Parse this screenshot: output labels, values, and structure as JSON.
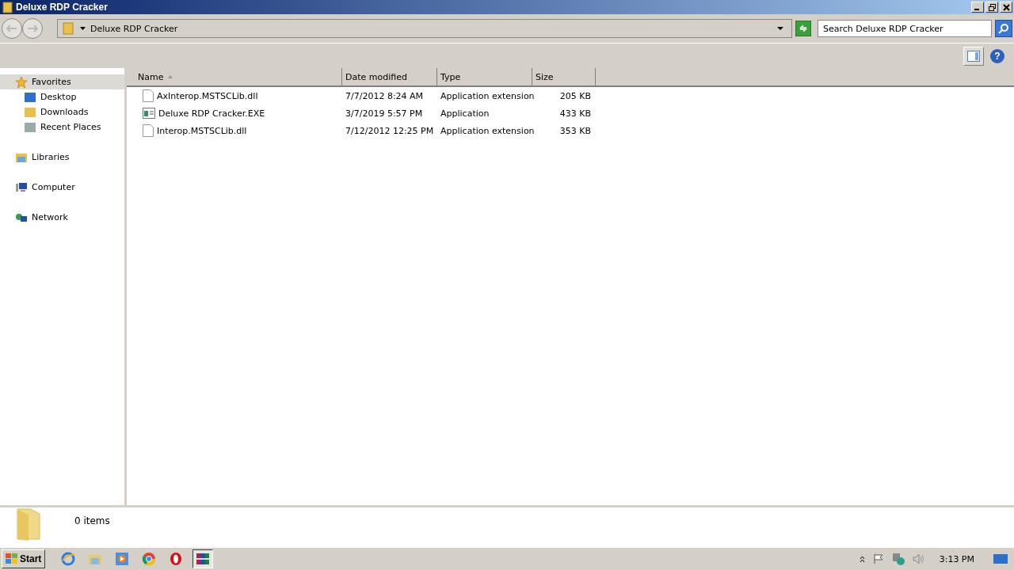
{
  "window": {
    "title": "Deluxe RDP Cracker"
  },
  "address_bar": {
    "path": "Deluxe RDP Cracker",
    "search_placeholder": "Search Deluxe RDP Cracker"
  },
  "navigation": [
    {
      "label": "Favorites",
      "selected": true,
      "children": [
        {
          "label": "Desktop",
          "selected": false
        },
        {
          "label": "Downloads",
          "selected": false
        },
        {
          "label": "Recent Places",
          "selected": false
        }
      ]
    },
    {
      "label": "Libraries",
      "selected": false
    },
    {
      "label": "Computer",
      "selected": false
    },
    {
      "label": "Network",
      "selected": false
    }
  ],
  "toolbar": {
    "help": "?"
  },
  "table": {
    "columns": [
      "Name",
      "Date modified",
      "Type",
      "Size"
    ],
    "rows": [
      {
        "kind": "dll",
        "name": "AxInterop.MSTSCLib.dll",
        "date": "7/7/2012 8:24 AM",
        "type": "Application extension",
        "size": "205 KB"
      },
      {
        "kind": "exe",
        "name": "Deluxe RDP Cracker.EXE",
        "date": "3/7/2019 5:57 PM",
        "type": "Application",
        "size": "433 KB"
      },
      {
        "kind": "dll",
        "name": "Interop.MSTSCLib.dll",
        "date": "7/12/2012 12:25 PM",
        "type": "Application extension",
        "size": "353 KB"
      }
    ]
  },
  "details_pane": {
    "count": "0 items"
  },
  "taskbar": {
    "start": "Start",
    "apps": [
      {
        "selected": false
      },
      {
        "selected": false
      },
      {
        "selected": false
      },
      {
        "selected": false
      },
      {
        "selected": false
      },
      {
        "selected": true
      }
    ],
    "clock": "3:13 PM"
  }
}
